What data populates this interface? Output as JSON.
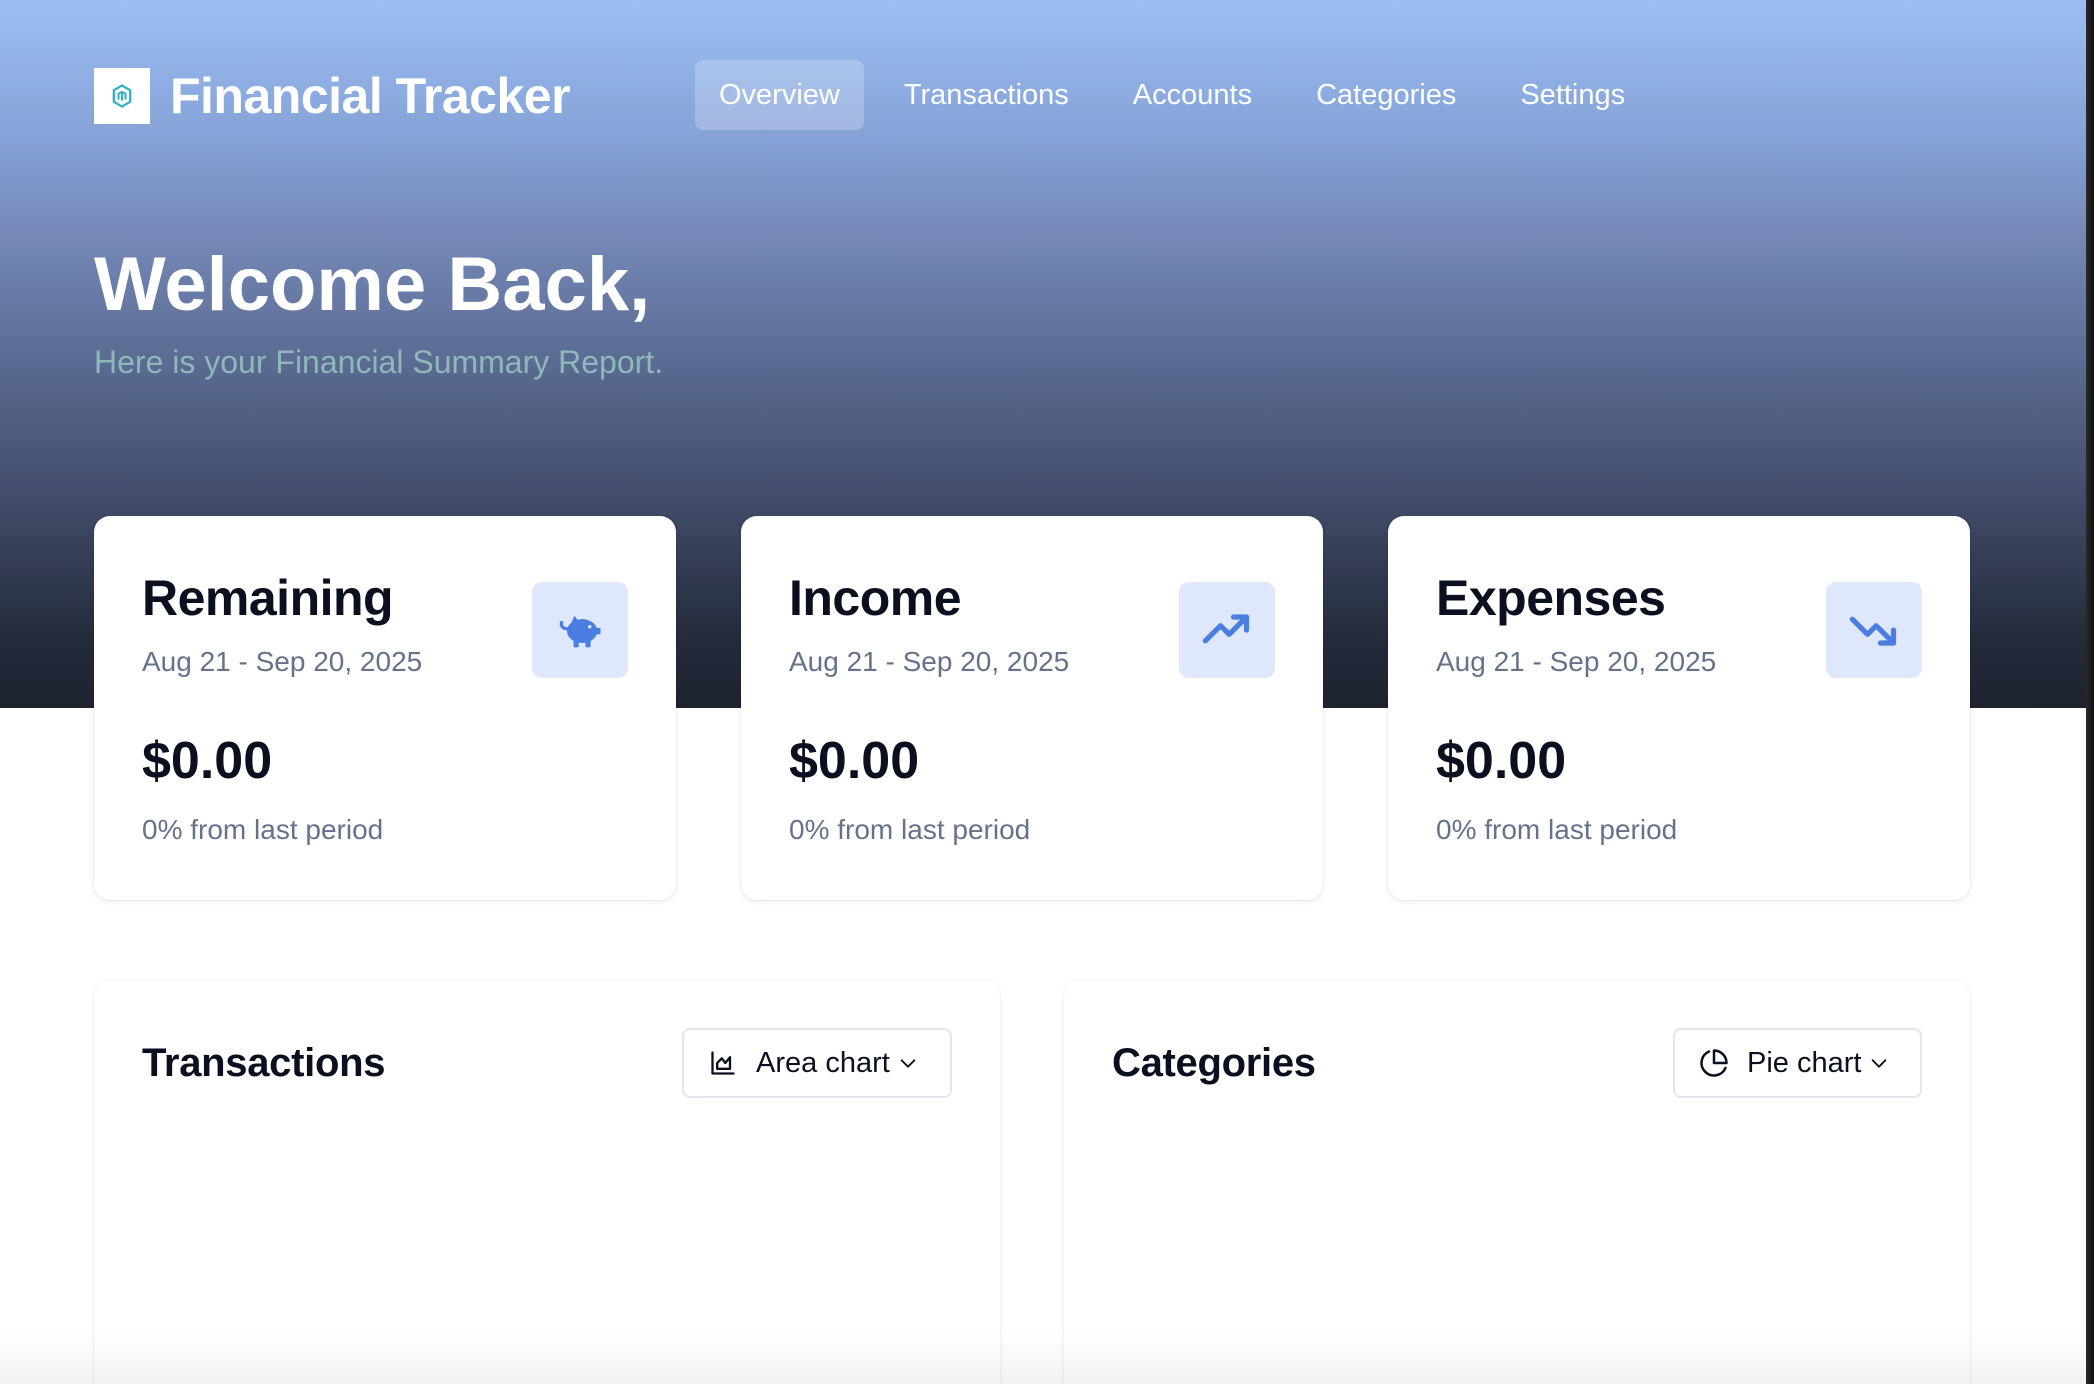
{
  "app": {
    "title": "Financial Tracker",
    "logo_icon": "hexagon-logo-icon"
  },
  "nav": {
    "items": [
      {
        "label": "Overview",
        "active": true
      },
      {
        "label": "Transactions",
        "active": false
      },
      {
        "label": "Accounts",
        "active": false
      },
      {
        "label": "Categories",
        "active": false
      },
      {
        "label": "Settings",
        "active": false
      }
    ]
  },
  "hero": {
    "welcome": "Welcome Back,",
    "subtitle": "Here is your Financial Summary Report."
  },
  "stats": [
    {
      "title": "Remaining",
      "range": "Aug 21 - Sep 20, 2025",
      "amount": "$0.00",
      "change": "0% from last period",
      "icon": "piggy-bank-icon"
    },
    {
      "title": "Income",
      "range": "Aug 21 - Sep 20, 2025",
      "amount": "$0.00",
      "change": "0% from last period",
      "icon": "trending-up-icon"
    },
    {
      "title": "Expenses",
      "range": "Aug 21 - Sep 20, 2025",
      "amount": "$0.00",
      "change": "0% from last period",
      "icon": "trending-down-icon"
    }
  ],
  "panels": {
    "transactions": {
      "title": "Transactions",
      "chart_type": "Area chart",
      "icon": "area-chart-icon"
    },
    "categories": {
      "title": "Categories",
      "chart_type": "Pie chart",
      "icon": "pie-chart-icon"
    }
  },
  "colors": {
    "accent": "#4a7ee0",
    "icon_bg": "#dfe7fd",
    "hero_top": "#9abff5",
    "hero_bottom": "#1d2330",
    "subtitle": "#8fb8b9"
  }
}
